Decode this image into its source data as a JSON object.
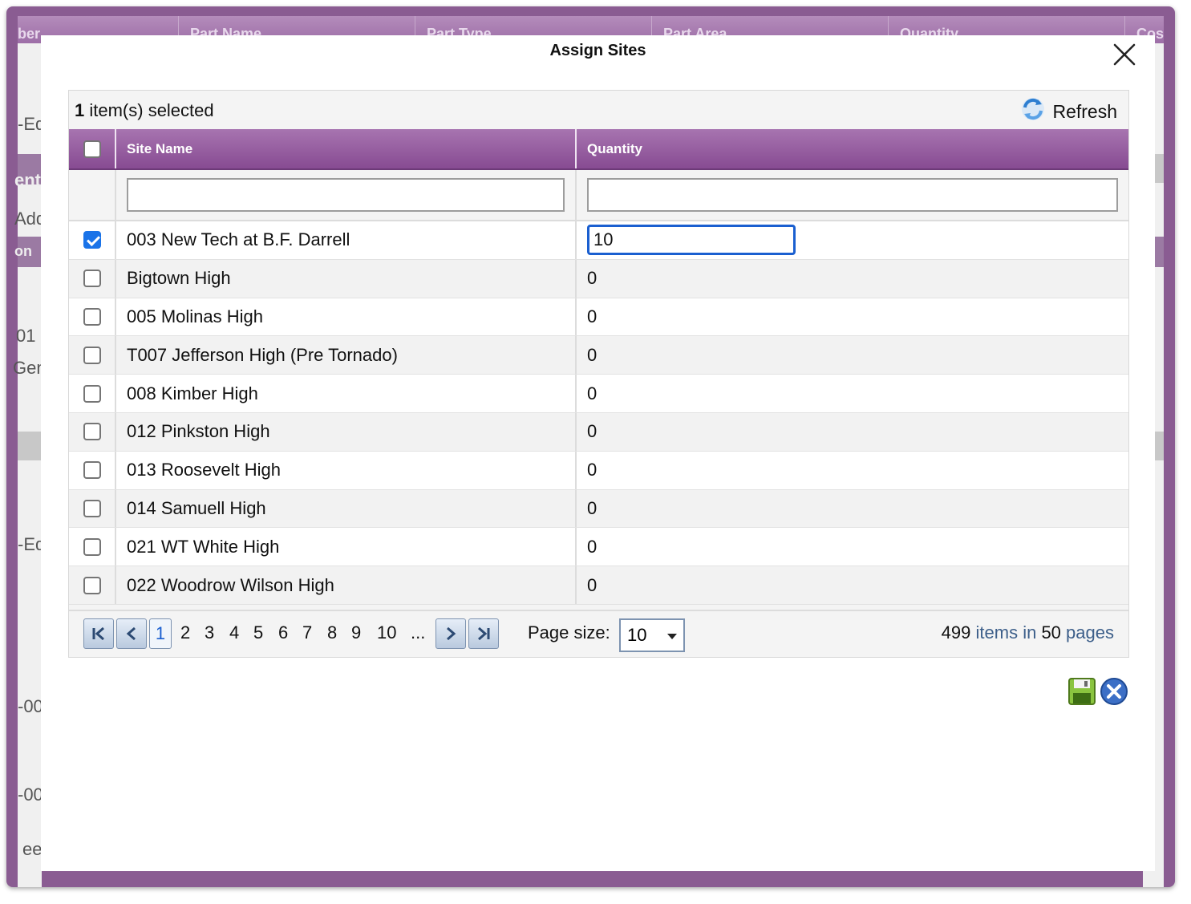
{
  "background": {
    "columns": [
      "ber",
      "Part Name",
      "Part Type",
      "Part Area",
      "Quantity",
      "Cos"
    ],
    "left_fragments": [
      "-Ed",
      "ent",
      "Add",
      "on",
      "01",
      "Gen",
      "-Ed",
      "-00",
      "-00",
      "ee"
    ]
  },
  "dialog": {
    "title": "Assign Sites",
    "close_icon": "close-icon"
  },
  "grid": {
    "selected_count": "1",
    "selected_text": " item(s) selected",
    "refresh_label": "Refresh",
    "refresh_icon": "refresh-icon",
    "columns": {
      "site_name": "Site Name",
      "quantity": "Quantity"
    },
    "filters": {
      "site_name": "",
      "quantity": ""
    },
    "rows": [
      {
        "checked": true,
        "site": "003 New Tech at B.F. Darrell",
        "quantity": "10"
      },
      {
        "checked": false,
        "site": "Bigtown High",
        "quantity": "0"
      },
      {
        "checked": false,
        "site": "005 Molinas High",
        "quantity": "0"
      },
      {
        "checked": false,
        "site": "T007 Jefferson High (Pre Tornado)",
        "quantity": "0"
      },
      {
        "checked": false,
        "site": "008 Kimber High",
        "quantity": "0"
      },
      {
        "checked": false,
        "site": "012 Pinkston High",
        "quantity": "0"
      },
      {
        "checked": false,
        "site": "013 Roosevelt High",
        "quantity": "0"
      },
      {
        "checked": false,
        "site": "014 Samuell High",
        "quantity": "0"
      },
      {
        "checked": false,
        "site": "021 WT White High",
        "quantity": "0"
      },
      {
        "checked": false,
        "site": "022 Woodrow Wilson High",
        "quantity": "0"
      }
    ]
  },
  "pager": {
    "pages": [
      "1",
      "2",
      "3",
      "4",
      "5",
      "6",
      "7",
      "8",
      "9",
      "10",
      "..."
    ],
    "current_page": "1",
    "page_size_label": "Page size:",
    "page_size": "10",
    "total_items": "499",
    "items_in_text": "items in",
    "total_pages": "50",
    "pages_text": "pages"
  },
  "actions": {
    "save_icon": "save-icon",
    "cancel_icon": "cancel-icon"
  },
  "colors": {
    "header_purple": "#874b92",
    "frame_purple": "#8a5c92",
    "accent_blue": "#1a73e8"
  }
}
